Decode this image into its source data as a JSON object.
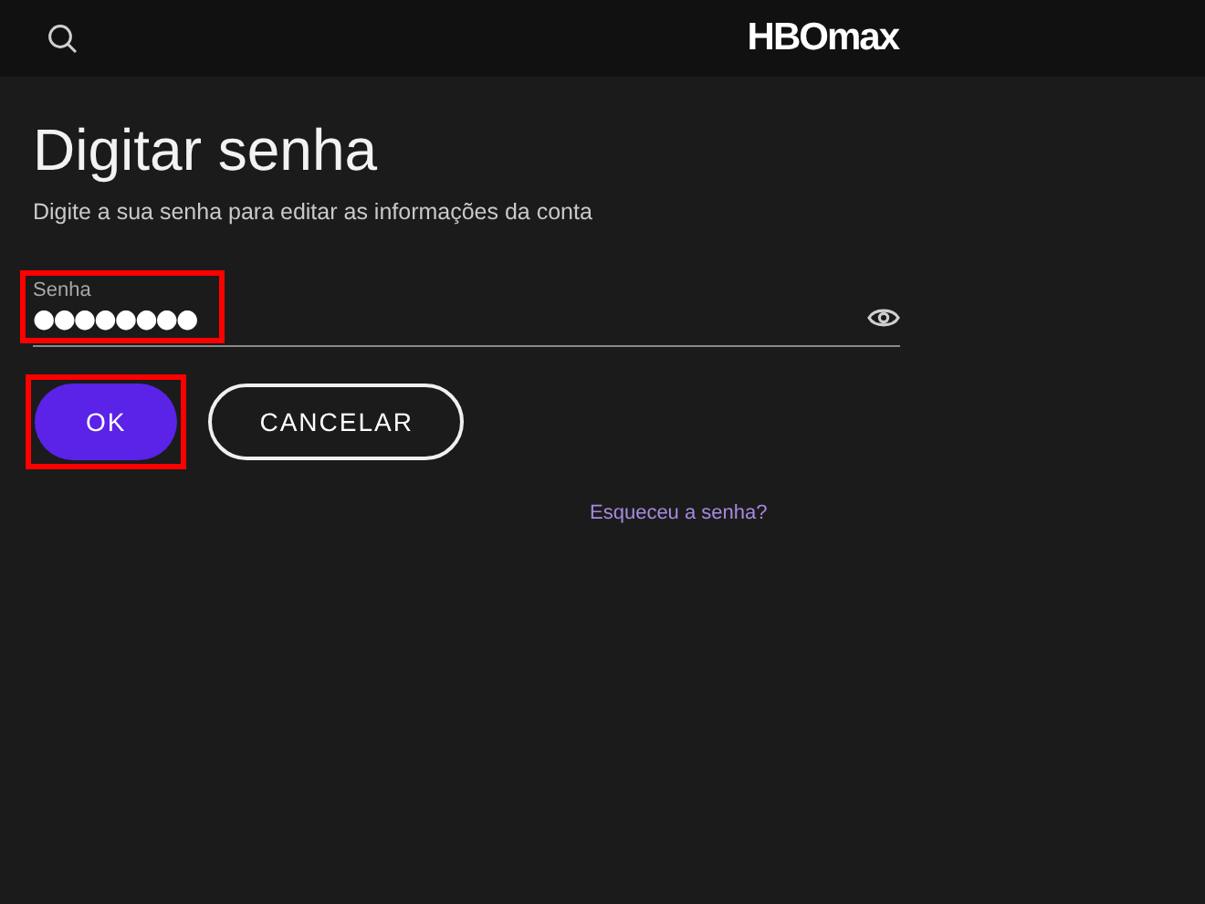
{
  "header": {
    "logo": "HBOmax"
  },
  "page": {
    "title": "Digitar senha",
    "subtitle": "Digite a sua senha para editar as informações da conta"
  },
  "password_field": {
    "label": "Senha",
    "value": "●●●●●●●●",
    "highlighted": true
  },
  "buttons": [
    {
      "label": "OK",
      "kind": "primary",
      "highlighted": true
    },
    {
      "label": "CANCELAR",
      "kind": "secondary",
      "highlighted": false
    }
  ],
  "forgot_link": "Esqueceu a senha?"
}
